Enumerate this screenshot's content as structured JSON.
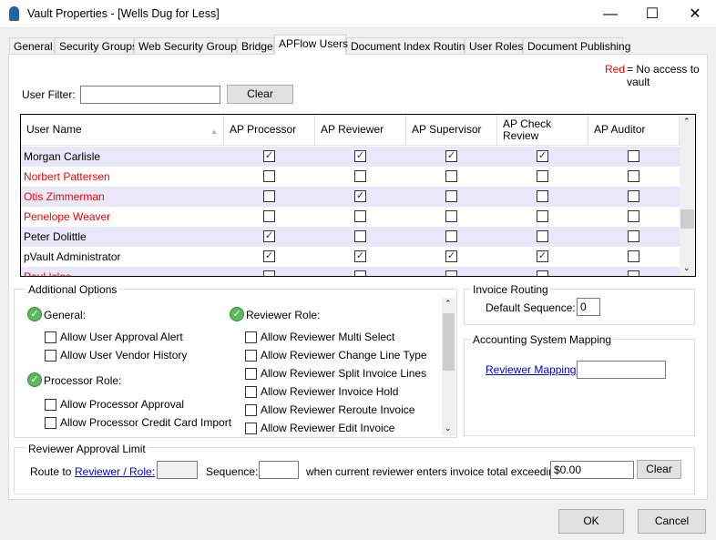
{
  "window": {
    "title": "Vault Properties - [Wells Dug for Less]",
    "minimize": "—",
    "maximize": "☐",
    "close": "✕"
  },
  "tabs": [
    "General",
    "Security Groups",
    "Web Security Groups",
    "Bridge",
    "APFlow Users",
    "Document Index Routing",
    "User Roles",
    "Document Publishing"
  ],
  "active_tab": "APFlow Users",
  "legend": {
    "red": "Red",
    "text": "= No access to vault",
    "color": "#ff0000"
  },
  "filter": {
    "label": "User Filter:",
    "value": "",
    "clear": "Clear"
  },
  "grid": {
    "columns": [
      "User Name",
      "AP Processor",
      "AP Reviewer",
      "AP Supervisor",
      "AP Check Review",
      "AP Auditor"
    ],
    "sort_indicator": "▲",
    "rows": [
      {
        "name": "Morgan Carlisle",
        "red": false,
        "checks": [
          true,
          true,
          true,
          true,
          false
        ]
      },
      {
        "name": "Norbert Pattersen",
        "red": true,
        "checks": [
          false,
          false,
          false,
          false,
          false
        ]
      },
      {
        "name": "Otis Zimmerman",
        "red": true,
        "checks": [
          false,
          true,
          false,
          false,
          false
        ]
      },
      {
        "name": "Penelope Weaver",
        "red": true,
        "checks": [
          false,
          false,
          false,
          false,
          false
        ]
      },
      {
        "name": "Peter Dolittle",
        "red": false,
        "checks": [
          true,
          false,
          false,
          false,
          false
        ]
      },
      {
        "name": "pVault Administrator",
        "red": false,
        "checks": [
          true,
          true,
          true,
          true,
          false
        ]
      },
      {
        "name": "Paul Islas",
        "red": true,
        "checks": [
          false,
          false,
          false,
          false,
          false
        ]
      }
    ]
  },
  "additional_options": {
    "title": "Additional Options",
    "general": {
      "label": "General:",
      "options": [
        "Allow User Approval Alert",
        "Allow User Vendor History"
      ]
    },
    "processor": {
      "label": "Processor Role:",
      "options": [
        "Allow Processor Approval",
        "Allow Processor Credit Card Import"
      ]
    },
    "reviewer": {
      "label": "Reviewer Role:",
      "options": [
        "Allow Reviewer Multi Select",
        "Allow Reviewer Change Line Type",
        "Allow Reviewer Split Invoice Lines",
        "Allow Reviewer Invoice Hold",
        "Allow Reviewer Reroute Invoice",
        "Allow Reviewer Edit Invoice"
      ]
    }
  },
  "invoice_routing": {
    "title": "Invoice Routing",
    "label": "Default Sequence:",
    "value": "0"
  },
  "accounting": {
    "title": "Accounting System Mapping",
    "link": "Reviewer Mapping:",
    "value": ""
  },
  "approval_limit": {
    "title": "Reviewer Approval Limit",
    "route_to": "Route to",
    "link": "Reviewer / Role:",
    "sequence_label": "Sequence:",
    "when_label": "when current reviewer enters invoice total exceeding:",
    "amount": "$0.00",
    "clear": "Clear"
  },
  "footer": {
    "ok": "OK",
    "cancel": "Cancel"
  }
}
